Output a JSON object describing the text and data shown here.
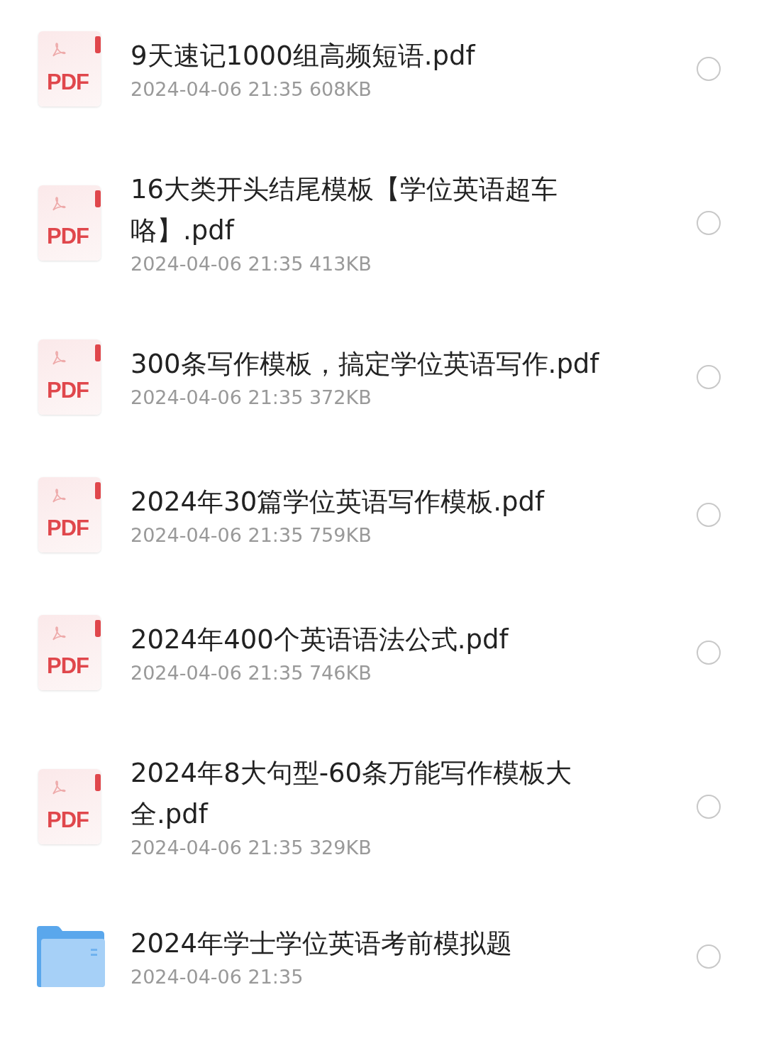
{
  "files": [
    {
      "kind": "pdf",
      "badge": "PDF",
      "name": "9天速记1000组高频短语.pdf",
      "meta": "2024-04-06 21:35  608KB",
      "selected": false
    },
    {
      "kind": "pdf",
      "badge": "PDF",
      "name": "16大类开头结尾模板【学位英语超车咯】.pdf",
      "meta": "2024-04-06 21:35  413KB",
      "selected": false
    },
    {
      "kind": "pdf",
      "badge": "PDF",
      "name": "300条写作模板，搞定学位英语写作.pdf",
      "meta": "2024-04-06 21:35  372KB",
      "selected": false
    },
    {
      "kind": "pdf",
      "badge": "PDF",
      "name": "2024年30篇学位英语写作模板.pdf",
      "meta": "2024-04-06 21:35  759KB",
      "selected": false
    },
    {
      "kind": "pdf",
      "badge": "PDF",
      "name": "2024年400个英语语法公式.pdf",
      "meta": "2024-04-06 21:35  746KB",
      "selected": false
    },
    {
      "kind": "pdf",
      "badge": "PDF",
      "name": "2024年8大句型-60条万能写作模板大全.pdf",
      "meta": "2024-04-06 21:35  329KB",
      "selected": false
    },
    {
      "kind": "folder",
      "name": "2024年学士学位英语考前模拟题",
      "meta": "2024-04-06 21:35",
      "selected": false
    }
  ]
}
